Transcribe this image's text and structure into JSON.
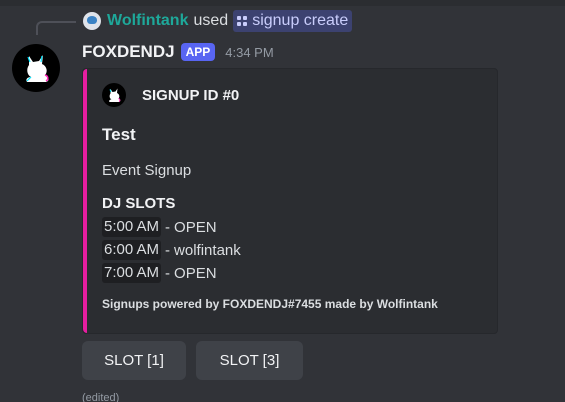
{
  "reply": {
    "user": "Wolfintank",
    "used_text": "used",
    "command": "signup create"
  },
  "message": {
    "author": "FOXDENDJ",
    "badge": "APP",
    "timestamp": "4:34 PM",
    "edited": "(edited)"
  },
  "embed": {
    "accent_color": "#e61ea0",
    "author": "SIGNUP ID #0",
    "title": "Test",
    "description": "Event Signup",
    "field_name": "DJ SLOTS",
    "slots": [
      {
        "time": "5:00 AM",
        "status": "OPEN"
      },
      {
        "time": "6:00 AM",
        "status": "wolfintank"
      },
      {
        "time": "7:00 AM",
        "status": "OPEN"
      }
    ],
    "separator": "-",
    "footer": "Signups powered by FOXDENDJ#7455 made by Wolfintank"
  },
  "buttons": [
    {
      "label": "SLOT [1]"
    },
    {
      "label": "SLOT [3]"
    }
  ],
  "colors": {
    "background": "#313338",
    "embed_background": "#2b2d31",
    "username_teal": "#1ea89a",
    "app_badge": "#5865f2"
  },
  "icons": {
    "reply_avatar": "user-avatar-icon",
    "command": "slash-command-icon",
    "bot_avatar": "fox-logo-icon"
  }
}
